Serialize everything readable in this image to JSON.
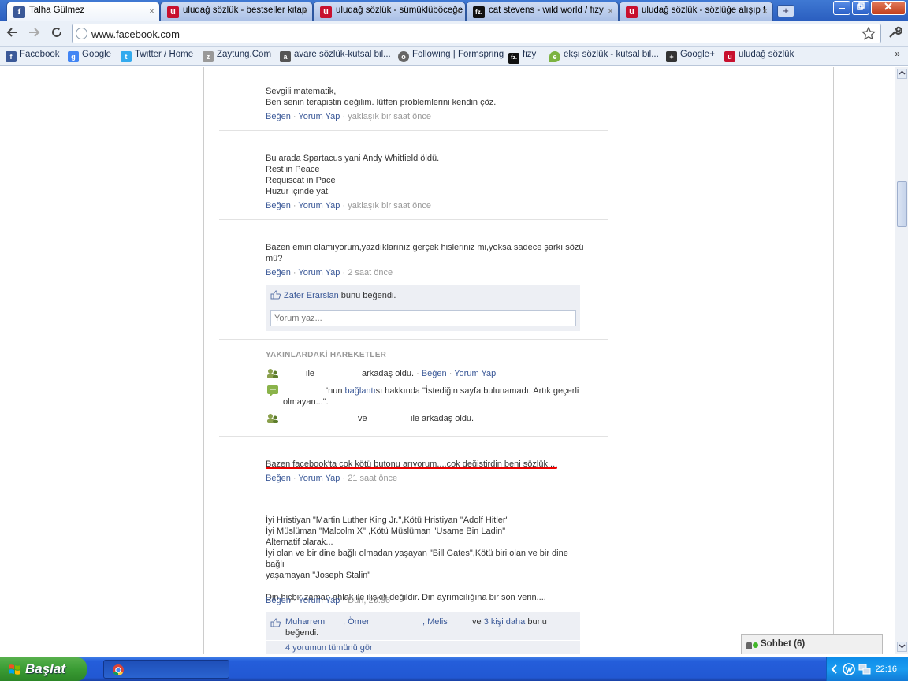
{
  "browser": {
    "tabs": [
      {
        "label": "Talha Gülmez",
        "icon": "fb",
        "active": true
      },
      {
        "label": "uludağ sözlük - bestseller kitap",
        "icon": "u"
      },
      {
        "label": "uludağ sözlük - sümüklüböceğe",
        "icon": "u"
      },
      {
        "label": "cat stevens - wild world / fizy",
        "icon": "fz"
      },
      {
        "label": "uludağ sözlük - sözlüğe alışıp f",
        "icon": "u"
      }
    ],
    "url": "www.facebook.com",
    "bookmarks": [
      {
        "label": "Facebook",
        "icon": "f"
      },
      {
        "label": "Google",
        "icon": "g"
      },
      {
        "label": "Twitter / Home",
        "icon": "t"
      },
      {
        "label": "Zaytung.Com",
        "icon": "z"
      },
      {
        "label": "avare sözlük-kutsal bil...",
        "icon": "a"
      },
      {
        "label": "Following | Formspring",
        "icon": "o"
      },
      {
        "label": "fizy",
        "icon": "fz."
      },
      {
        "label": "ekşi sözlük - kutsal bil...",
        "icon": "e"
      },
      {
        "label": "Google+",
        "icon": "+"
      },
      {
        "label": "uludağ sözlük",
        "icon": "u"
      }
    ],
    "bookmarks_more": "»",
    "tab_close": "×",
    "new_tab": "+",
    "fav_fb": "f",
    "fav_u": "u",
    "fav_fz": "fz."
  },
  "feed": {
    "like": "Beğen",
    "comment": "Yorum Yap",
    "dot": " · ",
    "posts": [
      {
        "lines": [
          "Sevgili matematik,",
          "Ben senin terapistin değilim. lütfen problemlerini kendin çöz."
        ],
        "time": "yaklaşık bir saat önce"
      },
      {
        "lines": [
          "Bu arada Spartacus yani Andy Whitfield öldü.",
          "Rest in Peace",
          "Requiscat in Pace",
          "Huzur içinde yat."
        ],
        "time": "yaklaşık bir saat önce"
      },
      {
        "lines": [
          "Bazen emin olamıyorum,yazdıklarınız gerçek hisleriniz mi,yoksa sadece şarkı sözü",
          "mü?"
        ],
        "time": "2 saat önce"
      },
      {
        "lines": [
          "Bazen facebook'ta çok kötü butonu arıyorum....çok değiştirdin beni sözlük...."
        ],
        "time": "21 saat önce"
      },
      {
        "lines": [
          "İyi Hristiyan \"Martin Luther King Jr.\",Kötü Hristiyan \"Adolf Hitler\"",
          "İyi Müslüman \"Malcolm X\" ,Kötü Müslüman \"Usame Bin Ladin\"",
          "Alternatif olarak...",
          "İyi olan ve bir dine bağlı olmadan yaşayan \"Bill Gates\",Kötü biri olan ve bir dine bağlı",
          "yaşamayan \"Joseph Stalin\"",
          "",
          "Din hiçbir zaman ahlak ile ilişkili değildir. Din ayrımcılığına bir son verin...."
        ],
        "time": "Dün, 20:36"
      }
    ],
    "post3_like": {
      "name": "Zafer Erarslan",
      "text": " bunu beğendi."
    },
    "comment_placeholder": "Yorum yaz...",
    "recent": {
      "title": "YAKINLARDAKİ HAREKETLER",
      "item1": {
        "a": "ile",
        "b": "arkadaş oldu."
      },
      "item2": {
        "a": "'nun ",
        "link": "bağlantı",
        "b": "sı hakkında \"İstediğin sayfa bulunamadı. Artık geçerli",
        "c": "olmayan...\"."
      },
      "item3": {
        "a": "ve",
        "b": "ile arkadaş oldu."
      }
    },
    "post5_likes": {
      "n1": "Muharrem",
      "n2": ", Ömer",
      "n3": ", Melis",
      "and": "ve ",
      "more": "3 kişi daha",
      "text": " bunu",
      "text2": "beğendi."
    },
    "cutoff_text": "4 yorumun tümünü gör"
  },
  "chat": {
    "label": "Sohbet (6)"
  },
  "taskbar": {
    "start": "Başlat",
    "clock": "22:16"
  }
}
